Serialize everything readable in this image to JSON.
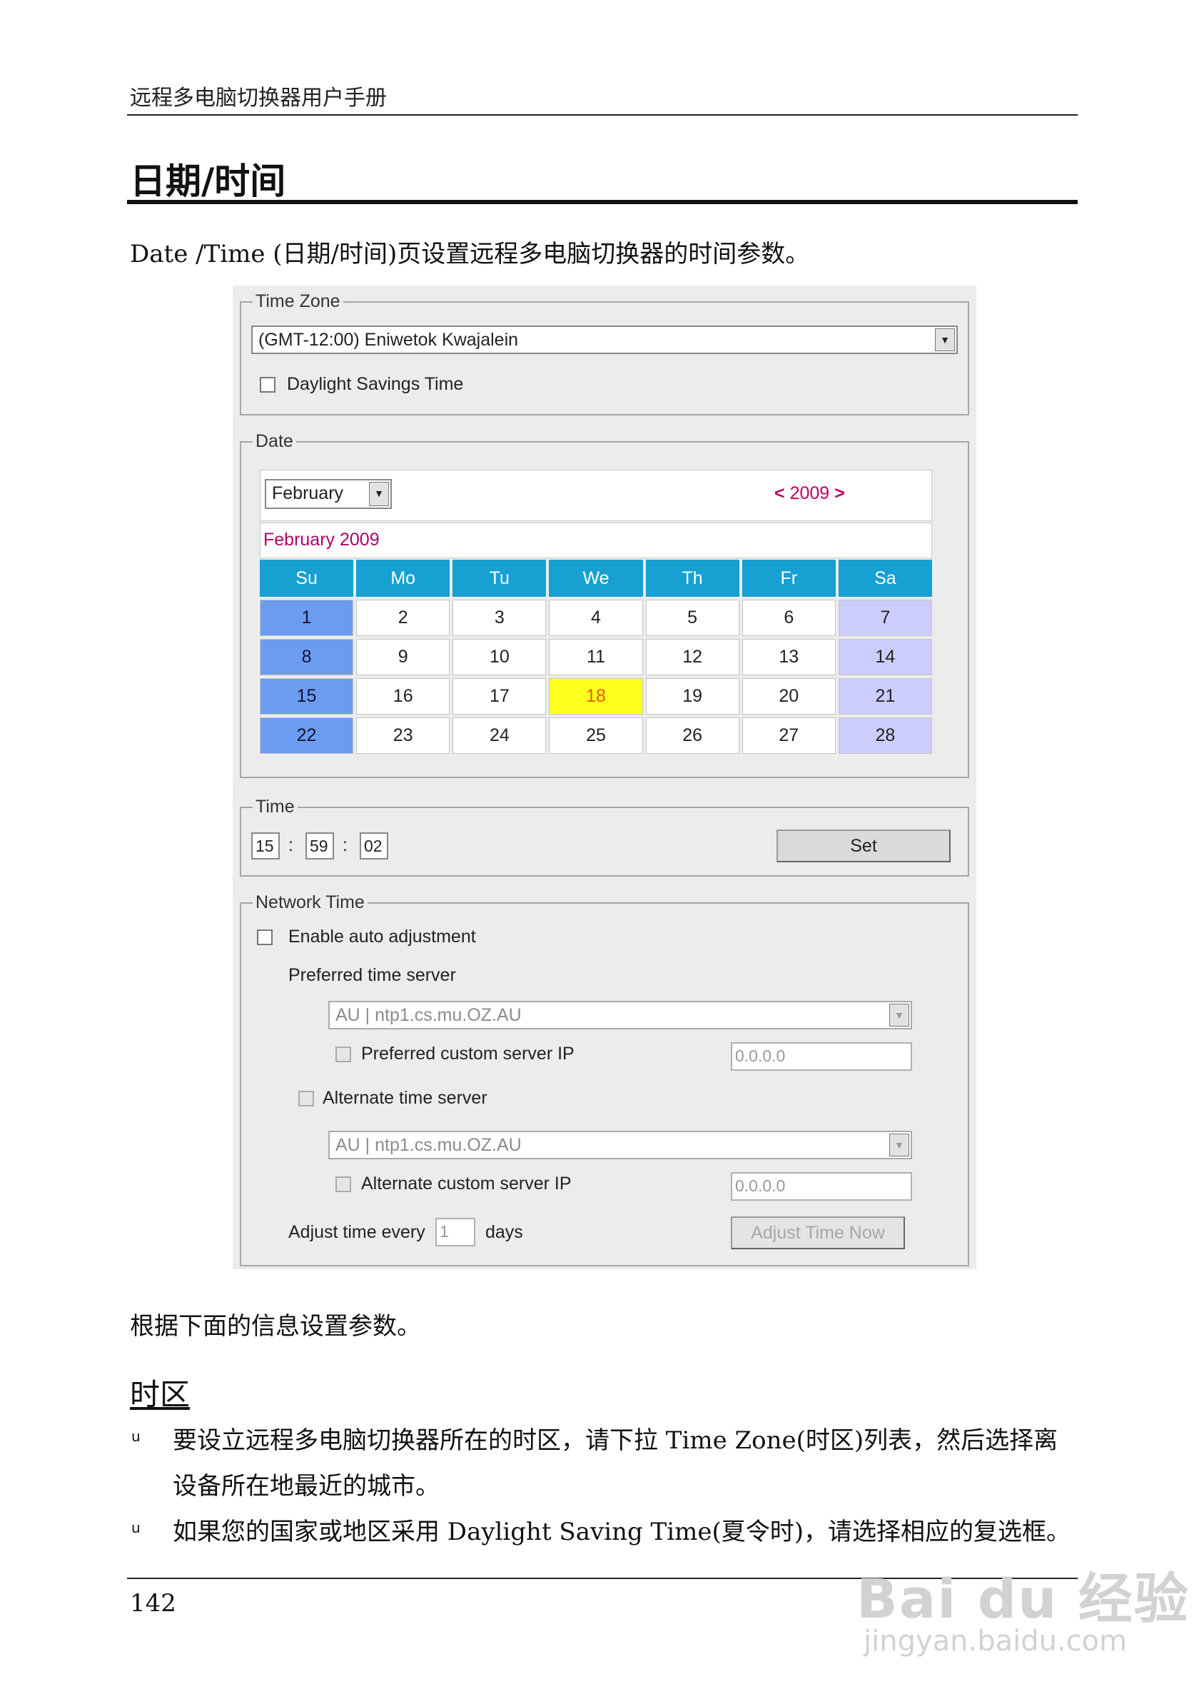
{
  "header": {
    "running_title": "远程多电脑切换器用户手册"
  },
  "section_title": "日期/时间",
  "intro": "Date /Time (日期/时间)页设置远程多电脑切换器的时间参数。",
  "timezone_group": {
    "legend": "Time Zone",
    "selected": "(GMT-12:00) Eniwetok Kwajalein",
    "dst_label": "Daylight Savings Time",
    "dst_checked": false
  },
  "date_group": {
    "legend": "Date",
    "month": "February",
    "year_prev": "<",
    "year": "2009",
    "year_next": ">",
    "title": "February 2009",
    "weekdays": [
      "Su",
      "Mo",
      "Tu",
      "We",
      "Th",
      "Fr",
      "Sa"
    ],
    "days": [
      "1",
      "2",
      "3",
      "4",
      "5",
      "6",
      "7",
      "8",
      "9",
      "10",
      "11",
      "12",
      "13",
      "14",
      "15",
      "16",
      "17",
      "18",
      "19",
      "20",
      "21",
      "22",
      "23",
      "24",
      "25",
      "26",
      "27",
      "28"
    ],
    "selected_day": "18"
  },
  "time_group": {
    "legend": "Time",
    "hour": "15",
    "minute": "59",
    "second": "02",
    "separator": ":",
    "set_label": "Set"
  },
  "network_group": {
    "legend": "Network Time",
    "enable_label": "Enable auto adjustment",
    "enable_checked": false,
    "preferred_server_label": "Preferred time server",
    "preferred_server_value": "AU | ntp1.cs.mu.OZ.AU",
    "preferred_custom_label": "Preferred custom server IP",
    "preferred_custom_ip": "0.0.0.0",
    "alternate_label": "Alternate time server",
    "alternate_server_value": "AU | ntp1.cs.mu.OZ.AU",
    "alternate_custom_label": "Alternate custom server IP",
    "alternate_custom_ip": "0.0.0.0",
    "adjust_label": "Adjust time every",
    "adjust_days": "1",
    "days_label": "days",
    "adjust_now_label": "Adjust Time Now"
  },
  "after_panel": "根据下面的信息设置参数。",
  "subsection": "时区",
  "bullet_marker": "u",
  "bullets": [
    {
      "line1": "要设立远程多电脑切换器所在的时区，请下拉 Time Zone(时区)列表，然后选择离",
      "line2": "设备所在地最近的城市。"
    },
    {
      "line1": "如果您的国家或地区采用 Daylight Saving Time(夏令时)，请选择相应的复选框。"
    }
  ],
  "page_number": "142",
  "watermark": {
    "brand": "Bai du 经验",
    "url": "jingyan.baidu.com"
  }
}
